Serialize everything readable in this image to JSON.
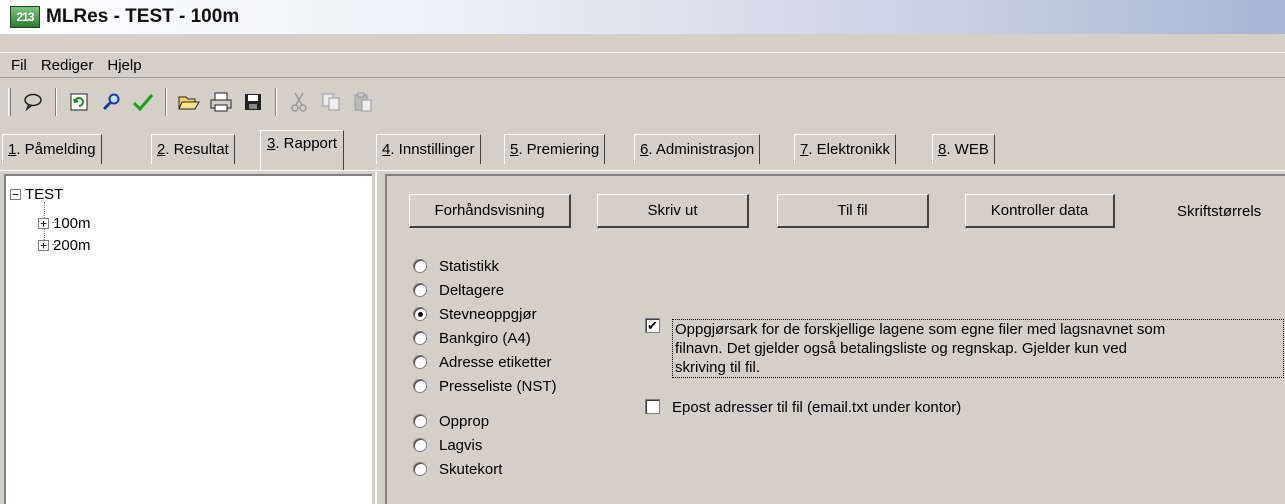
{
  "window": {
    "title": "MLRes - TEST - 100m",
    "icon": "app-icon",
    "icon_text": "213"
  },
  "menu": {
    "items": [
      "Fil",
      "Rediger",
      "Hjelp"
    ]
  },
  "toolbar": {
    "icons": [
      "balloon-icon",
      "refresh-icon",
      "search-icon",
      "check-icon",
      "open-folder-icon",
      "print-icon",
      "save-icon",
      "cut-icon",
      "copy-icon",
      "paste-icon"
    ]
  },
  "tabs": [
    {
      "key": "1",
      "label": ". Påmelding"
    },
    {
      "key": "2",
      "label": ". Resultat"
    },
    {
      "key": "3",
      "label": ". Rapport",
      "active": true
    },
    {
      "key": "4",
      "label": ". Innstillinger"
    },
    {
      "key": "5",
      "label": ". Premiering"
    },
    {
      "key": "6",
      "label": ". Administrasjon"
    },
    {
      "key": "7",
      "label": ". Elektronikk"
    },
    {
      "key": "8",
      "label": ". WEB"
    }
  ],
  "tree": {
    "root": "TEST",
    "children": [
      "100m",
      "200m"
    ]
  },
  "report": {
    "buttons": {
      "preview": "Forhåndsvisning",
      "print": "Skriv ut",
      "to_file": "Til fil",
      "check_data": "Kontroller data"
    },
    "font_size_label": "Skriftstørrels",
    "options": [
      "Statistikk",
      "Deltagere",
      "Stevneoppgjør",
      "Bankgiro (A4)",
      "Adresse etiketter",
      "Presseliste (NST)",
      "Opprop",
      "Lagvis",
      "Skutekort"
    ],
    "selected_option": "Stevneoppgjør",
    "checkbox_settlement": {
      "checked": true,
      "lines": [
        "Oppgjørsark for de forskjellige lagene som egne filer med lagsnavnet som",
        "filnavn. Det gjelder også betalingsliste og regnskap. Gjelder kun ved",
        "skriving til fil."
      ]
    },
    "checkbox_email": {
      "checked": false,
      "label": "Epost adresser til fil (email.txt under kontor)"
    }
  }
}
